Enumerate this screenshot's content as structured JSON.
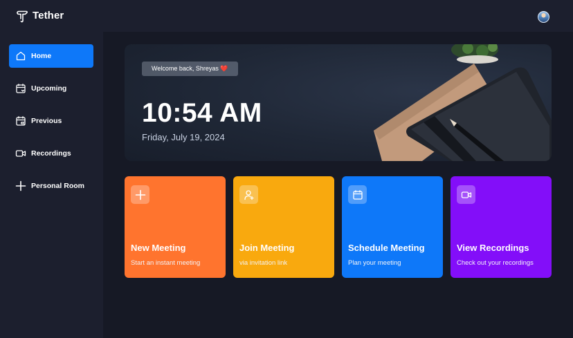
{
  "app": {
    "brand": "Tether"
  },
  "sidebar": {
    "items": [
      {
        "label": "Home",
        "icon": "home-icon",
        "active": true
      },
      {
        "label": "Upcoming",
        "icon": "calendar-upcoming-icon",
        "active": false
      },
      {
        "label": "Previous",
        "icon": "calendar-previous-icon",
        "active": false
      },
      {
        "label": "Recordings",
        "icon": "video-icon",
        "active": false
      },
      {
        "label": "Personal Room",
        "icon": "plus-icon",
        "active": false
      }
    ]
  },
  "hero": {
    "welcome": "Welcome back, Shreyas ❤️",
    "time": "10:54 AM",
    "date": "Friday, July 19, 2024"
  },
  "cards": [
    {
      "title": "New Meeting",
      "subtitle": "Start an instant meeting",
      "icon": "plus-icon",
      "color": "#ff742e"
    },
    {
      "title": "Join Meeting",
      "subtitle": "via invitation link",
      "icon": "add-user-icon",
      "color": "#f9a90e"
    },
    {
      "title": "Schedule Meeting",
      "subtitle": "Plan your meeting",
      "icon": "calendar-icon",
      "color": "#0e78f9"
    },
    {
      "title": "View Recordings",
      "subtitle": "Check out your recordings",
      "icon": "video-icon",
      "color": "#830ef9"
    }
  ],
  "colors": {
    "background": "#161925",
    "panel": "#1c1f2e",
    "accent": "#0e78f9"
  }
}
